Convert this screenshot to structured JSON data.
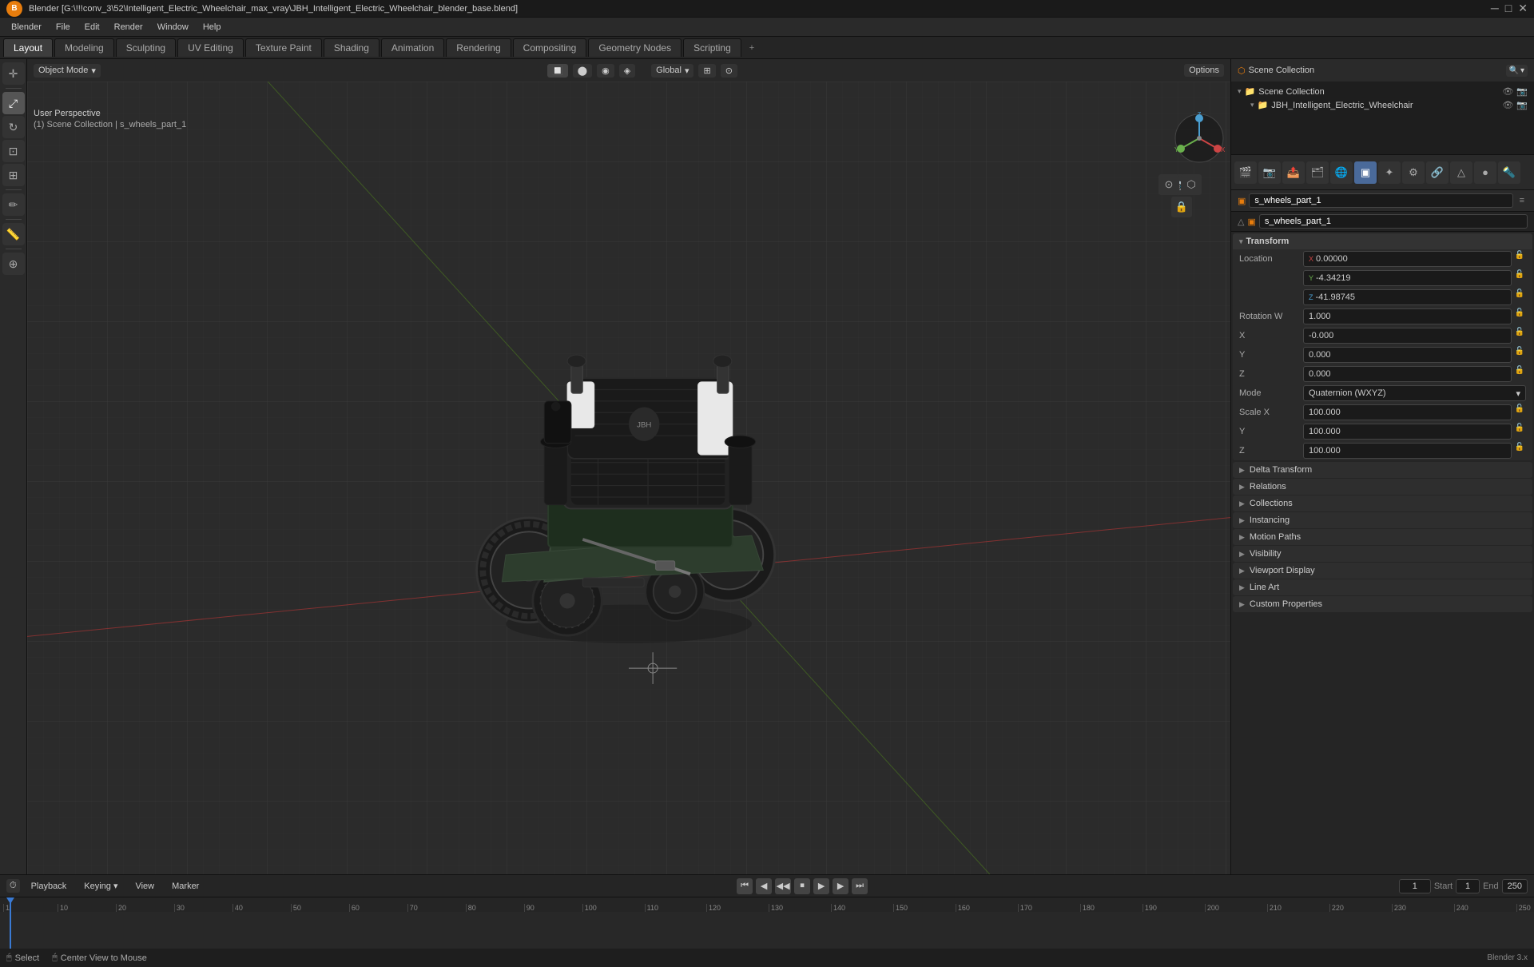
{
  "titlebar": {
    "text": "Blender [G:\\!!!conv_3\\52\\Intelligent_Electric_Wheelchair_max_vray\\JBH_Intelligent_Electric_Wheelchair_blender_base.blend]",
    "controls": [
      "minimize",
      "maximize",
      "close"
    ]
  },
  "menubar": {
    "items": [
      "Blender",
      "File",
      "Edit",
      "Render",
      "Window",
      "Help"
    ]
  },
  "workspace_tabs": {
    "tabs": [
      "Layout",
      "Modeling",
      "Sculpting",
      "UV Editing",
      "Texture Paint",
      "Shading",
      "Animation",
      "Rendering",
      "Compositing",
      "Geometry Nodes",
      "Scripting"
    ],
    "active": "Layout",
    "add": "+"
  },
  "viewport_header": {
    "mode": "Object Mode",
    "viewport_shading": "Solid",
    "global": "Global",
    "options_btn": "Options"
  },
  "viewport_info": {
    "perspective": "User Perspective",
    "collection": "(1) Scene Collection | s_wheels_part_1"
  },
  "left_tools": {
    "tools": [
      "cursor",
      "move",
      "rotate",
      "scale",
      "transform",
      "annotate",
      "measure",
      "add"
    ]
  },
  "viewport_right_tools": {
    "tools": [
      "gizmo",
      "view",
      "move_view",
      "camera",
      "shading_a",
      "shading_b",
      "shading_c",
      "shading_d",
      "overlay",
      "xray"
    ]
  },
  "gizmo": {
    "x_label": "X",
    "y_label": "Y",
    "z_label": "Z"
  },
  "outliner": {
    "title": "Scene Collection",
    "items": [
      {
        "name": "JBH_Intelligent_Electric_Wheelchair",
        "icon": "collection",
        "selected": false
      }
    ]
  },
  "properties": {
    "icon_tabs": [
      "scene",
      "render",
      "output",
      "view_layer",
      "scene2",
      "world",
      "object",
      "particles",
      "physics",
      "constraints",
      "data",
      "material",
      "shader"
    ],
    "active_tab": "object",
    "object_name": "s_wheels_part_1",
    "data_name": "s_wheels_part_1",
    "transform": {
      "label": "Transform",
      "location": {
        "label": "Location",
        "x": "0.00000",
        "y": "-4.34219",
        "z": "-41.98745"
      },
      "rotation": {
        "label": "Rotation",
        "w": "1.000",
        "x": "-0.000",
        "y": "0.000",
        "z": "0.000",
        "mode": "Quaternion (WXYZ)"
      },
      "scale": {
        "label": "Scale",
        "x": "100.000",
        "y": "100.000",
        "z": "100.000"
      }
    },
    "sections": [
      {
        "label": "Delta Transform",
        "collapsed": true
      },
      {
        "label": "Relations",
        "collapsed": true
      },
      {
        "label": "Collections",
        "collapsed": true
      },
      {
        "label": "Instancing",
        "collapsed": true
      },
      {
        "label": "Motion Paths",
        "collapsed": true
      },
      {
        "label": "Visibility",
        "collapsed": true
      },
      {
        "label": "Viewport Display",
        "collapsed": true
      },
      {
        "label": "Line Art",
        "collapsed": true
      },
      {
        "label": "Custom Properties",
        "collapsed": true
      }
    ]
  },
  "timeline": {
    "playback_label": "Playback",
    "keying_label": "Keying",
    "view_label": "View",
    "marker_label": "Marker",
    "frame_current": "1",
    "start_label": "Start",
    "start_frame": "1",
    "end_label": "End",
    "end_frame": "250",
    "markers": [
      "1",
      "10",
      "20",
      "30",
      "40",
      "50",
      "60",
      "70",
      "80",
      "90",
      "100",
      "110",
      "120",
      "130",
      "140",
      "150",
      "160",
      "170",
      "180",
      "190",
      "200",
      "210",
      "220",
      "230",
      "240",
      "250"
    ]
  },
  "statusbar": {
    "select_label": "Select",
    "center_view_label": "Center View to Mouse"
  }
}
